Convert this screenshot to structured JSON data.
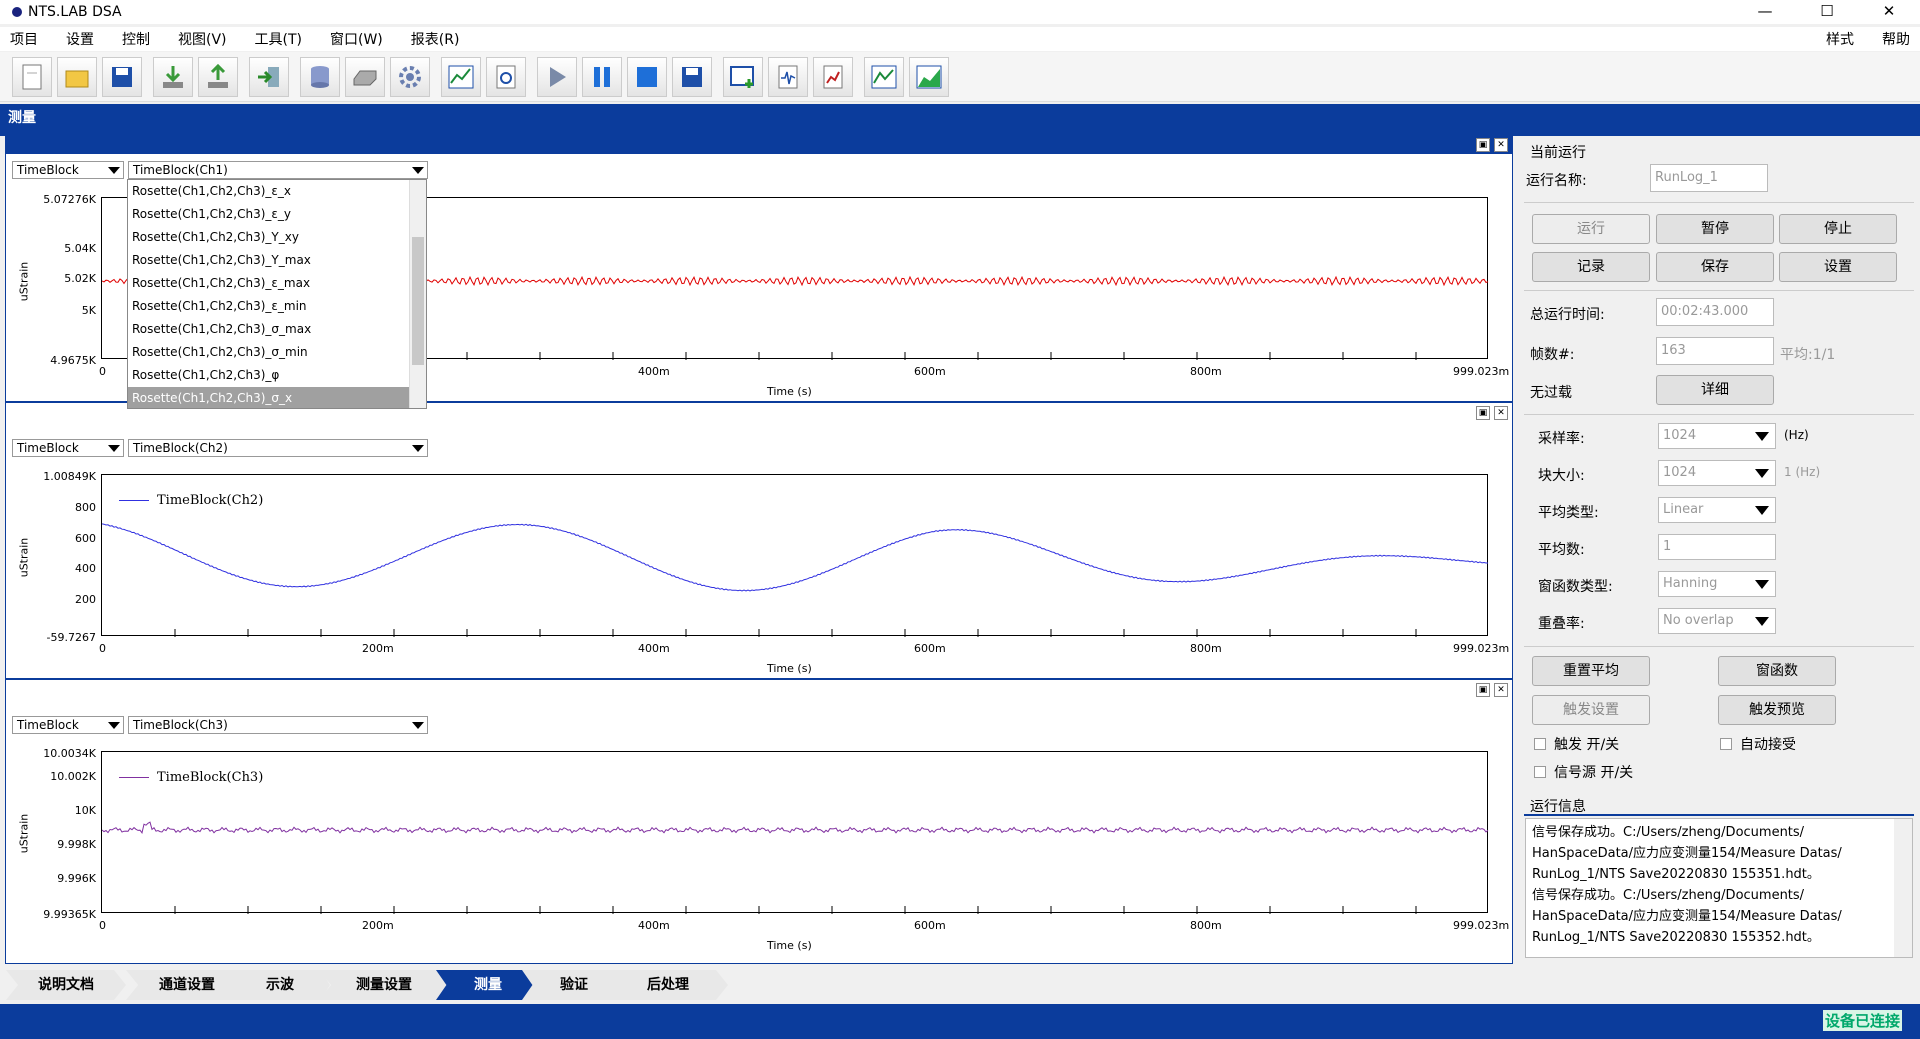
{
  "app": {
    "title": "NTS.LAB DSA"
  },
  "window_controls": {
    "minimize": "—",
    "maximize": "☐",
    "close": "✕"
  },
  "menu": {
    "items": [
      "项目",
      "设置",
      "控制",
      "视图(V)",
      "工具(T)",
      "窗口(W)",
      "报表(R)"
    ],
    "right_items": [
      "样式",
      "帮助"
    ]
  },
  "toolbar_icons": [
    "new-icon",
    "open-folder-icon",
    "save-icon",
    "import-icon",
    "export-icon",
    "exit-icon",
    "database-icon",
    "disk-icon",
    "gear-icon",
    "chart-icon",
    "page-settings-icon",
    "play-icon",
    "pause-icon",
    "stop-icon",
    "save-data-icon",
    "add-window-icon",
    "signal-icon",
    "report-icon",
    "trend-icon",
    "area-chart-icon"
  ],
  "section": {
    "title": "测量"
  },
  "panels": [
    {
      "type_combo": "TimeBlock",
      "channel_combo": "TimeBlock(Ch1)",
      "ylabel": "uStrain",
      "xlabel": "Time (s)",
      "yticks": [
        "5.07276K",
        "5.04K",
        "5.02K",
        "5K",
        "4.9675K"
      ],
      "xticks": [
        "0",
        "400m",
        "600m",
        "800m",
        "999.023m"
      ],
      "legend": "",
      "color": "#e00000"
    },
    {
      "type_combo": "TimeBlock",
      "channel_combo": "TimeBlock(Ch2)",
      "ylabel": "uStrain",
      "xlabel": "Time (s)",
      "yticks": [
        "1.00849K",
        "800",
        "600",
        "400",
        "200",
        "-59.7267"
      ],
      "xticks": [
        "0",
        "200m",
        "400m",
        "600m",
        "800m",
        "999.023m"
      ],
      "legend": "TimeBlock(Ch2)",
      "color": "#3030e0"
    },
    {
      "type_combo": "TimeBlock",
      "channel_combo": "TimeBlock(Ch3)",
      "ylabel": "uStrain",
      "xlabel": "Time (s)",
      "yticks": [
        "10.0034K",
        "10.002K",
        "10K",
        "9.998K",
        "9.996K",
        "9.99365K"
      ],
      "xticks": [
        "0",
        "200m",
        "400m",
        "600m",
        "800m",
        "999.023m"
      ],
      "legend": "TimeBlock(Ch3)",
      "color": "#8030a0"
    }
  ],
  "dropdown_options": [
    "Rosette(Ch1,Ch2,Ch3)_ε_x",
    "Rosette(Ch1,Ch2,Ch3)_ε_y",
    "Rosette(Ch1,Ch2,Ch3)_Y_xy",
    "Rosette(Ch1,Ch2,Ch3)_Y_max",
    "Rosette(Ch1,Ch2,Ch3)_ε_max",
    "Rosette(Ch1,Ch2,Ch3)_ε_min",
    "Rosette(Ch1,Ch2,Ch3)_σ_max",
    "Rosette(Ch1,Ch2,Ch3)_σ_min",
    "Rosette(Ch1,Ch2,Ch3)_φ",
    "Rosette(Ch1,Ch2,Ch3)_σ_x"
  ],
  "run": {
    "current_run_label": "当前运行",
    "run_name_label": "运行名称:",
    "run_name_value": "RunLog_1",
    "buttons_row1": [
      "运行",
      "暂停",
      "停止"
    ],
    "buttons_row2": [
      "记录",
      "保存",
      "设置"
    ],
    "total_time_label": "总运行时间:",
    "total_time_value": "00:02:43.000",
    "frames_label": "帧数#:",
    "frames_value": "163",
    "average_label": "平均:1/1",
    "overload_label": "无过载",
    "detail_button": "详细",
    "sample_rate_label": "采样率:",
    "sample_rate_value": "1024",
    "sample_rate_unit": "(Hz)",
    "block_size_label": "块大小:",
    "block_size_value": "1024",
    "block_size_unit": "1 (Hz)",
    "avg_type_label": "平均类型:",
    "avg_type_value": "Linear",
    "avg_count_label": "平均数:",
    "avg_count_value": "1",
    "window_type_label": "窗函数类型:",
    "window_type_value": "Hanning",
    "overlap_label": "重叠率:",
    "overlap_value": "No overlap",
    "reset_avg_button": "重置平均",
    "window_func_button": "窗函数",
    "trigger_settings_button": "触发设置",
    "trigger_preview_button": "触发预览",
    "trigger_toggle": "触发 开/关",
    "auto_accept": "自动接受",
    "signal_source_toggle": "信号源 开/关",
    "run_info_label": "运行信息",
    "log_lines": [
      "信号保存成功。C:/Users/zheng/Documents/",
      "HanSpaceData/应力应变测量154/Measure Datas/",
      "RunLog_1/NTS Save20220830 155351.hdt。",
      "信号保存成功。C:/Users/zheng/Documents/",
      "HanSpaceData/应力应变测量154/Measure Datas/",
      "RunLog_1/NTS Save20220830 155352.hdt。"
    ]
  },
  "tabs": [
    "说明文档",
    "通道设置",
    "示波",
    "测量设置",
    "测量",
    "验证",
    "后处理"
  ],
  "active_tab": "测量",
  "status": {
    "text": "设备已连接"
  }
}
